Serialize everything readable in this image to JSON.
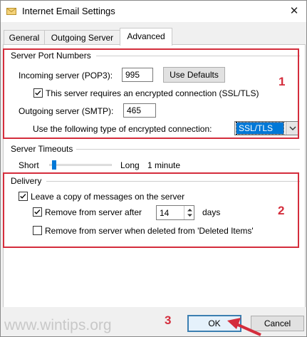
{
  "window": {
    "title": "Internet Email Settings",
    "close_glyph": "✕"
  },
  "tabs": [
    {
      "label": "General"
    },
    {
      "label": "Outgoing Server"
    },
    {
      "label": "Advanced"
    }
  ],
  "server_ports": {
    "group_label": "Server Port Numbers",
    "incoming_label": "Incoming server (POP3):",
    "incoming_value": "995",
    "use_defaults_label": "Use Defaults",
    "encrypted_label": "This server requires an encrypted connection (SSL/TLS)",
    "encrypted_checked": true,
    "outgoing_label": "Outgoing server (SMTP):",
    "outgoing_value": "465",
    "encryption_type_label": "Use the following type of encrypted connection:",
    "encryption_type_value": "SSL/TLS"
  },
  "timeouts": {
    "group_label": "Server Timeouts",
    "short_label": "Short",
    "long_label": "Long",
    "value_label": "1 minute",
    "slider_level": 0.05
  },
  "delivery": {
    "group_label": "Delivery",
    "leave_copy_label": "Leave a copy of messages on the server",
    "leave_copy_checked": true,
    "remove_after_label": "Remove from server after",
    "remove_after_checked": true,
    "remove_after_value": "14",
    "days_label": "days",
    "remove_deleted_label": "Remove from server when deleted from 'Deleted Items'",
    "remove_deleted_checked": false
  },
  "annotations": {
    "n1": "1",
    "n2": "2",
    "n3": "3"
  },
  "footer": {
    "ok_label": "OK",
    "cancel_label": "Cancel"
  },
  "watermark": "www.wintips.org",
  "colors": {
    "annotation_red": "#d42d3c",
    "selection_blue": "#0078d7",
    "focus_blue": "#3c7fb1"
  }
}
